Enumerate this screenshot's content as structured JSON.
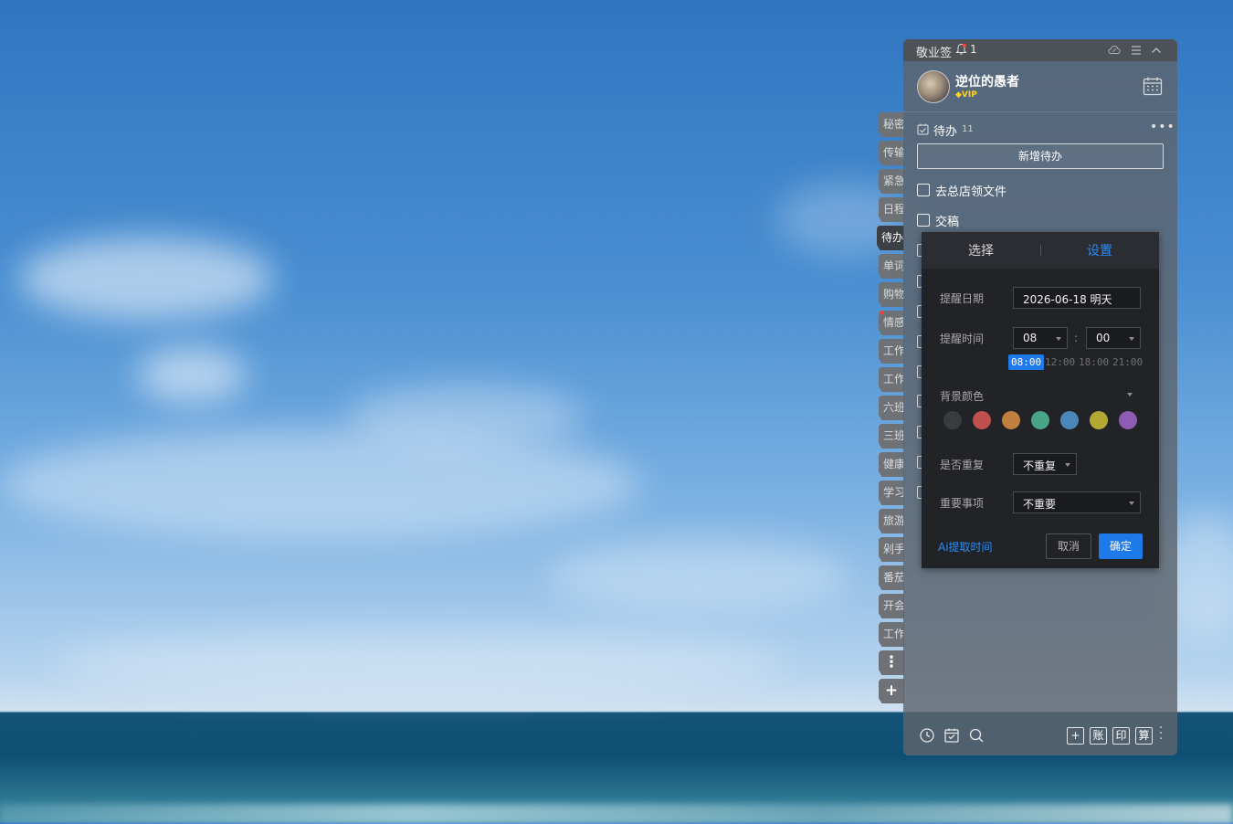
{
  "app": {
    "title": "敬业签",
    "notification_count": "1"
  },
  "user": {
    "name": "逆位的愚者",
    "badge": "VIP"
  },
  "side_tabs": [
    "秘密",
    "传输",
    "紧急",
    "日程",
    "待办",
    "单词",
    "购物",
    "情感",
    "工作",
    "工作",
    "六班",
    "三班",
    "健康",
    "学习",
    "旅游",
    "剁手",
    "番茄",
    "开会",
    "工作"
  ],
  "side_tab_active": "待办",
  "todo": {
    "title": "待办",
    "count": "11",
    "add_label": "新增待办",
    "items": [
      "去总店领文件",
      "交稿"
    ]
  },
  "popup": {
    "tab_select": "选择",
    "tab_settings": "设置",
    "reminder_date_label": "提醒日期",
    "reminder_date_value": "2026-06-18 明天",
    "reminder_time_label": "提醒时间",
    "hour": "08",
    "minute": "00",
    "colon": ":",
    "presets": [
      "08:00",
      "12:00",
      "18:00",
      "21:00"
    ],
    "bg_color_label": "背景颜色",
    "colors": [
      "#3a3b3f",
      "#c0504d",
      "#c07f3d",
      "#4aa486",
      "#4a87b8",
      "#b4a834",
      "#8d5cb3"
    ],
    "repeat_label": "是否重复",
    "repeat_value": "不重复",
    "important_label": "重要事项",
    "important_value": "不重要",
    "ai_link": "Ai提取时间",
    "cancel": "取消",
    "ok": "确定"
  },
  "bottom_bar": {
    "boxes": [
      "+",
      "账",
      "印",
      "算"
    ]
  }
}
